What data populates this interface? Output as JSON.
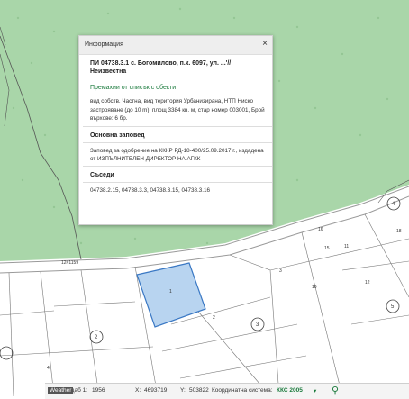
{
  "popup": {
    "title": "Информация",
    "parcel_title": "ПИ 04738.3.1 с. Богомилово, п.к. 6097, ул. ...'// Неизвестна",
    "remove_link": "Премахни от списък с обекти",
    "description": "вид собств. Частна, вид територия Урбанизирана, НТП Ниско застрояване (до 10 m), площ 3384 кв. м, стар номер 003001, Брой върхове: 6 бр.",
    "order_heading": "Основна заповед",
    "order_text": "Заповед за одобрение на КККР РД-18-400/25.09.2017 г., издадена от ИЗПЪЛНИТЕЛЕН ДИРЕКТОР НА АГКК",
    "neighbors_heading": "Съседи",
    "neighbors": "04738.2.15, 04738.3.3, 04738.3.15, 04738.3.16"
  },
  "map_labels": {
    "road": "12#1159",
    "parcel_1": "1",
    "parcel_2": "2",
    "parcel_3": "3",
    "circle_2": "2",
    "circle_3": "3",
    "circle_4": "4",
    "circle_5": "5",
    "n16": "16",
    "n15": "15",
    "n10": "10",
    "n11": "11",
    "n18": "18",
    "n12": "12",
    "n4": "4"
  },
  "statusbar": {
    "scale_label": "Мащаб 1:",
    "scale_value": "1956",
    "x_label": "X:",
    "x_value": "4693719",
    "y_label": "Y:",
    "y_value": "503822",
    "crs_label": "Координатна система:",
    "crs_value": "ККС 2005",
    "weather": "Weather"
  },
  "colors": {
    "forest": "#a9d6a9",
    "road": "#ffffff",
    "selected_parcel": "#b8d4f0",
    "selected_outline": "#3a78c4",
    "link": "#1a7a3c"
  }
}
